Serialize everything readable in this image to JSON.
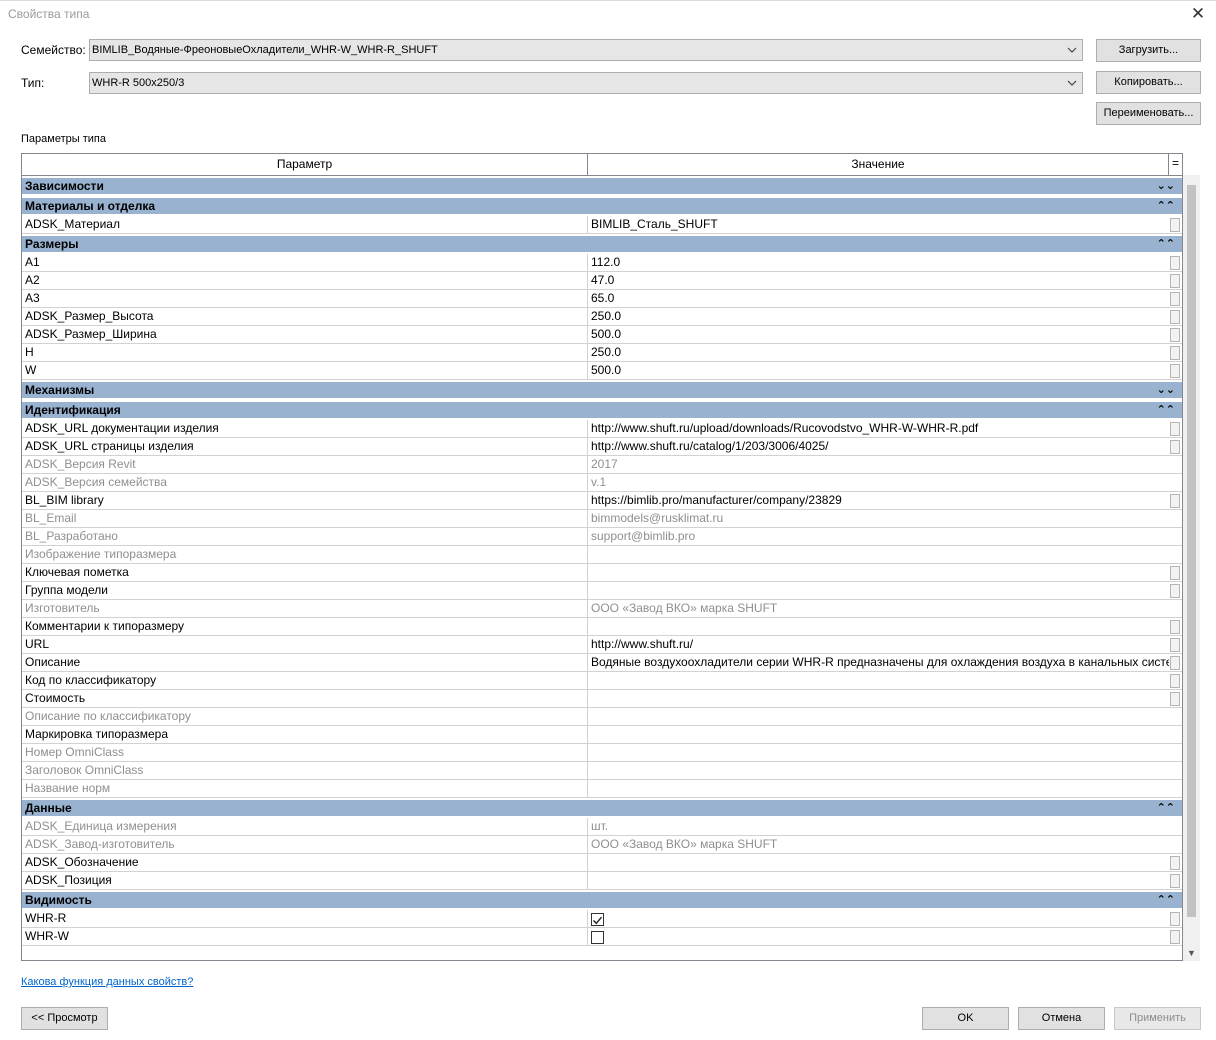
{
  "window": {
    "title": "Свойства типа",
    "close_glyph": "✕"
  },
  "family": {
    "label": "Семейство:",
    "value": "BIMLIB_Водяные-ФреоновыеОхладители_WHR-W_WHR-R_SHUFT"
  },
  "type": {
    "label": "Тип:",
    "value": "WHR-R 500x250/3"
  },
  "buttons": {
    "load": "Загрузить...",
    "duplicate": "Копировать...",
    "rename": "Переименовать...",
    "preview": "<< Просмотр",
    "ok": "OK",
    "cancel": "Отмена",
    "apply": "Применить"
  },
  "section_label": "Параметры типа",
  "grid": {
    "col_param": "Параметр",
    "col_value": "Значение",
    "col_eq": "=",
    "groups": [
      {
        "name": "Зависимости",
        "chevron": "⌄⌄",
        "rows": []
      },
      {
        "name": "Материалы и отделка",
        "chevron": "⌃⌃",
        "rows": [
          {
            "param": "ADSK_Материал",
            "value": "BIMLIB_Сталь_SHUFT",
            "dim": false,
            "edit": true
          }
        ]
      },
      {
        "name": "Размеры",
        "chevron": "⌃⌃",
        "rows": [
          {
            "param": "A1",
            "value": "112.0",
            "dim": false,
            "edit": true
          },
          {
            "param": "A2",
            "value": "47.0",
            "dim": false,
            "edit": true
          },
          {
            "param": "A3",
            "value": "65.0",
            "dim": false,
            "edit": true
          },
          {
            "param": "ADSK_Размер_Высота",
            "value": "250.0",
            "dim": false,
            "edit": true
          },
          {
            "param": "ADSK_Размер_Ширина",
            "value": "500.0",
            "dim": false,
            "edit": true
          },
          {
            "param": "H",
            "value": "250.0",
            "dim": false,
            "edit": true
          },
          {
            "param": "W",
            "value": "500.0",
            "dim": false,
            "edit": true
          }
        ]
      },
      {
        "name": "Механизмы",
        "chevron": "⌄⌄",
        "rows": []
      },
      {
        "name": "Идентификация",
        "chevron": "⌃⌃",
        "rows": [
          {
            "param": "ADSK_URL документации изделия",
            "value": "http://www.shuft.ru/upload/downloads/Rucovodstvo_WHR-W-WHR-R.pdf",
            "dim": false,
            "edit": true
          },
          {
            "param": "ADSK_URL страницы изделия",
            "value": "http://www.shuft.ru/catalog/1/203/3006/4025/",
            "dim": false,
            "edit": true
          },
          {
            "param": "ADSK_Версия Revit",
            "value": "2017",
            "dim": true,
            "edit": false
          },
          {
            "param": "ADSK_Версия семейства",
            "value": "v.1",
            "dim": true,
            "edit": false
          },
          {
            "param": "BL_BIM library",
            "value": "https://bimlib.pro/manufacturer/company/23829",
            "dim": false,
            "edit": true
          },
          {
            "param": "BL_Email",
            "value": "bimmodels@rusklimat.ru",
            "dim": true,
            "edit": false
          },
          {
            "param": "BL_Разработано",
            "value": "support@bimlib.pro",
            "dim": true,
            "edit": false
          },
          {
            "param": "Изображение типоразмера",
            "value": "",
            "dim": true,
            "edit": false
          },
          {
            "param": "Ключевая пометка",
            "value": "",
            "dim": false,
            "edit": true
          },
          {
            "param": "Группа модели",
            "value": "",
            "dim": false,
            "edit": true
          },
          {
            "param": "Изготовитель",
            "value": "ООО «Завод ВКО» марка SHUFT",
            "dim": true,
            "edit": false
          },
          {
            "param": "Комментарии к типоразмеру",
            "value": "",
            "dim": false,
            "edit": true
          },
          {
            "param": "URL",
            "value": "http://www.shuft.ru/",
            "dim": false,
            "edit": true
          },
          {
            "param": "Описание",
            "value": "Водяные воздухоохладители серии WHR-R предназначены для охлаждения воздуха в канальных систем",
            "dim": false,
            "edit": true
          },
          {
            "param": "Код по классификатору",
            "value": "",
            "dim": false,
            "edit": true
          },
          {
            "param": "Стоимость",
            "value": "",
            "dim": false,
            "edit": true
          },
          {
            "param": "Описание по классификатору",
            "value": "",
            "dim": true,
            "edit": false
          },
          {
            "param": "Маркировка типоразмера",
            "value": "",
            "dim": false,
            "edit": false
          },
          {
            "param": "Номер OmniClass",
            "value": "",
            "dim": true,
            "edit": false
          },
          {
            "param": "Заголовок OmniClass",
            "value": "",
            "dim": true,
            "edit": false
          },
          {
            "param": "Название норм",
            "value": "",
            "dim": true,
            "edit": false
          }
        ]
      },
      {
        "name": "Данные",
        "chevron": "⌃⌃",
        "rows": [
          {
            "param": "ADSK_Единица измерения",
            "value": "шт.",
            "dim": true,
            "edit": false
          },
          {
            "param": "ADSK_Завод-изготовитель",
            "value": "ООО «Завод ВКО» марка SHUFT",
            "dim": true,
            "edit": false
          },
          {
            "param": "ADSK_Обозначение",
            "value": "",
            "dim": false,
            "edit": true
          },
          {
            "param": "ADSK_Позиция",
            "value": "",
            "dim": false,
            "edit": true
          }
        ]
      },
      {
        "name": "Видимость",
        "chevron": "⌃⌃",
        "rows": [
          {
            "param": "WHR-R",
            "value": "",
            "dim": false,
            "edit": true,
            "checkbox": true,
            "checked": true
          },
          {
            "param": "WHR-W",
            "value": "",
            "dim": false,
            "edit": true,
            "checkbox": true,
            "checked": false
          }
        ]
      }
    ]
  },
  "help_link": "Какова функция данных свойств?"
}
